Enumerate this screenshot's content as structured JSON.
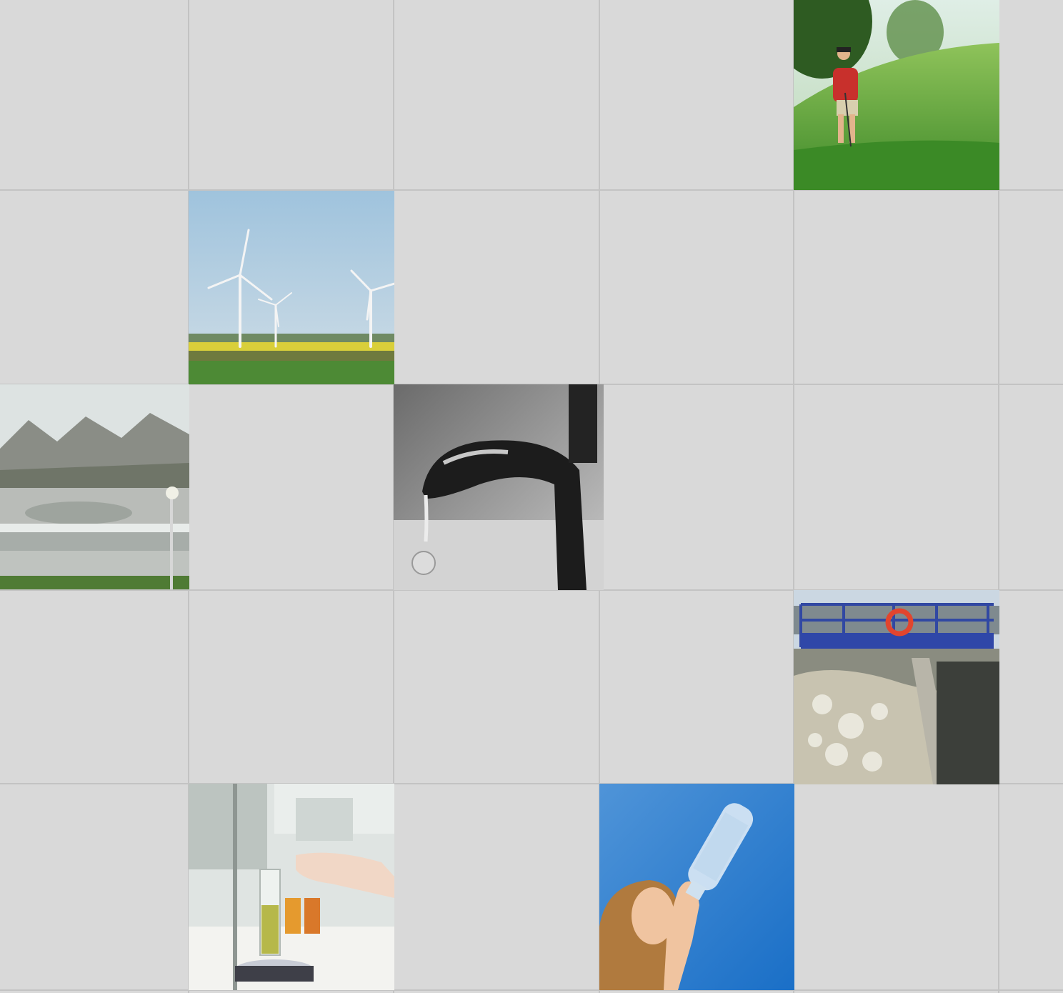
{
  "page": {
    "background": "#d9d9d9",
    "gridline_color": "#c3c3c3"
  },
  "grid": {
    "columns": 6,
    "rows": 6
  },
  "tiles": [
    {
      "name": "golf-putting-photo",
      "row": 1,
      "column": 5
    },
    {
      "name": "wind-turbines-photo",
      "row": 2,
      "column": 2
    },
    {
      "name": "water-treatment-plant-photo",
      "row": 3,
      "column": 1
    },
    {
      "name": "dripping-tap-photo",
      "row": 3,
      "column": 3
    },
    {
      "name": "aeration-tank-photo",
      "row": 4,
      "column": 5
    },
    {
      "name": "laboratory-beaker-photo",
      "row": 5,
      "column": 2
    },
    {
      "name": "woman-drinking-water-photo",
      "row": 5,
      "column": 4
    }
  ]
}
